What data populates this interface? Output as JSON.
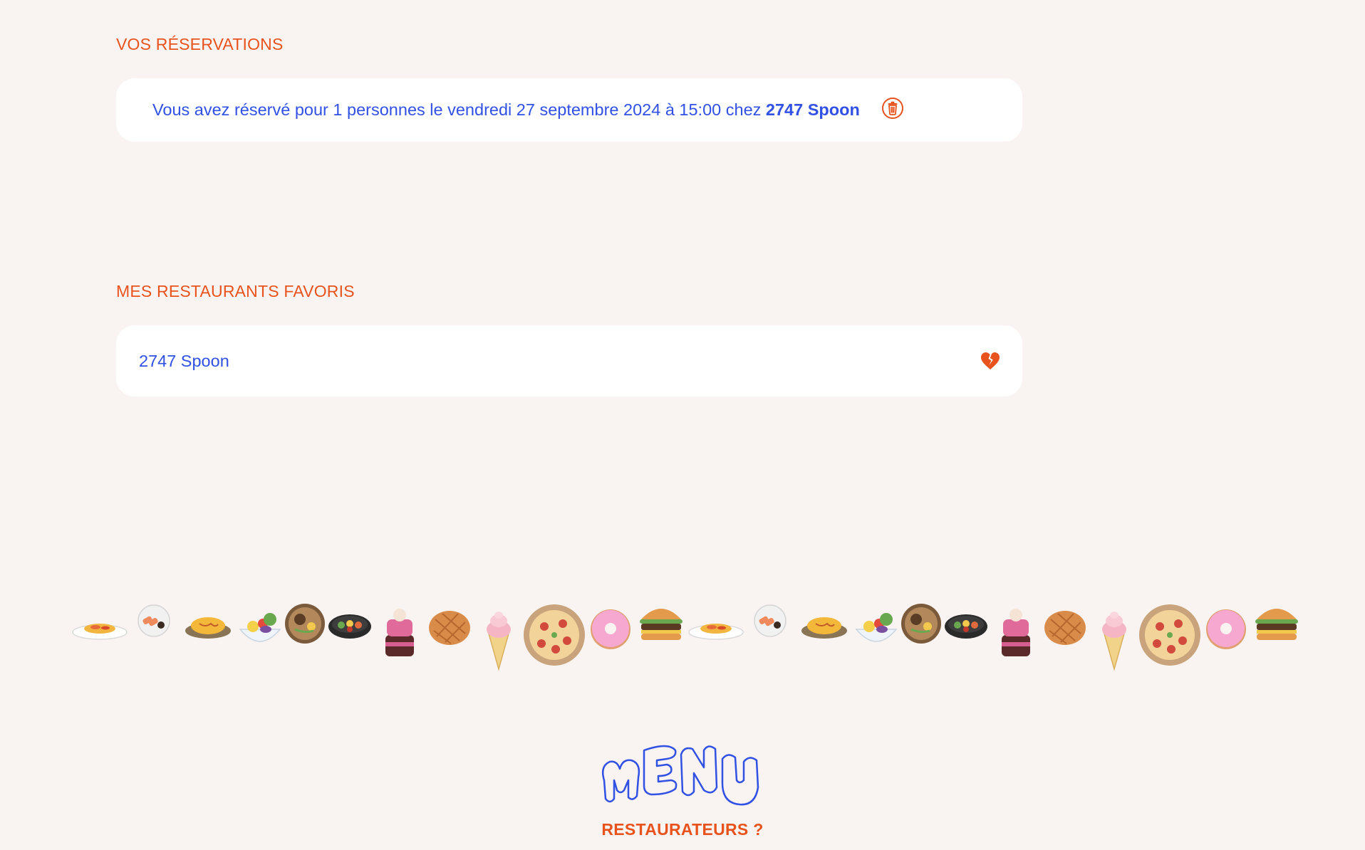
{
  "reservations": {
    "title": "VOS RÉSERVATIONS",
    "items": [
      {
        "text": "Vous avez réservé pour 1 personnes le vendredi 27 septembre 2024 à 15:00 chez ",
        "restaurant": "2747 Spoon",
        "delete_icon": "trash-icon"
      }
    ]
  },
  "favorites": {
    "title": "MES RESTAURANTS FAVORIS",
    "items": [
      {
        "name": "2747 Spoon",
        "remove_icon": "broken-heart-icon"
      }
    ]
  },
  "food_banner": {
    "icons": [
      "pasta-plate",
      "sushi-plate",
      "omelette-rice",
      "salad-bowl",
      "ramen-bowl",
      "bibimbap",
      "layer-cake",
      "melon-bread",
      "ice-cream-cone",
      "pizza",
      "donut",
      "burger",
      "pasta-plate",
      "sushi-plate",
      "omelette-rice",
      "salad-bowl",
      "ramen-bowl",
      "bibimbap",
      "layer-cake",
      "melon-bread",
      "ice-cream-cone",
      "pizza",
      "donut",
      "burger"
    ]
  },
  "footer": {
    "logo_icon": "menu-logo",
    "restaurateurs_label": "RESTAURATEURS ?"
  },
  "colors": {
    "background": "#f9f4f1",
    "accent_orange": "#e8531d",
    "text_blue": "#3150e4",
    "card_bg": "#ffffff"
  }
}
